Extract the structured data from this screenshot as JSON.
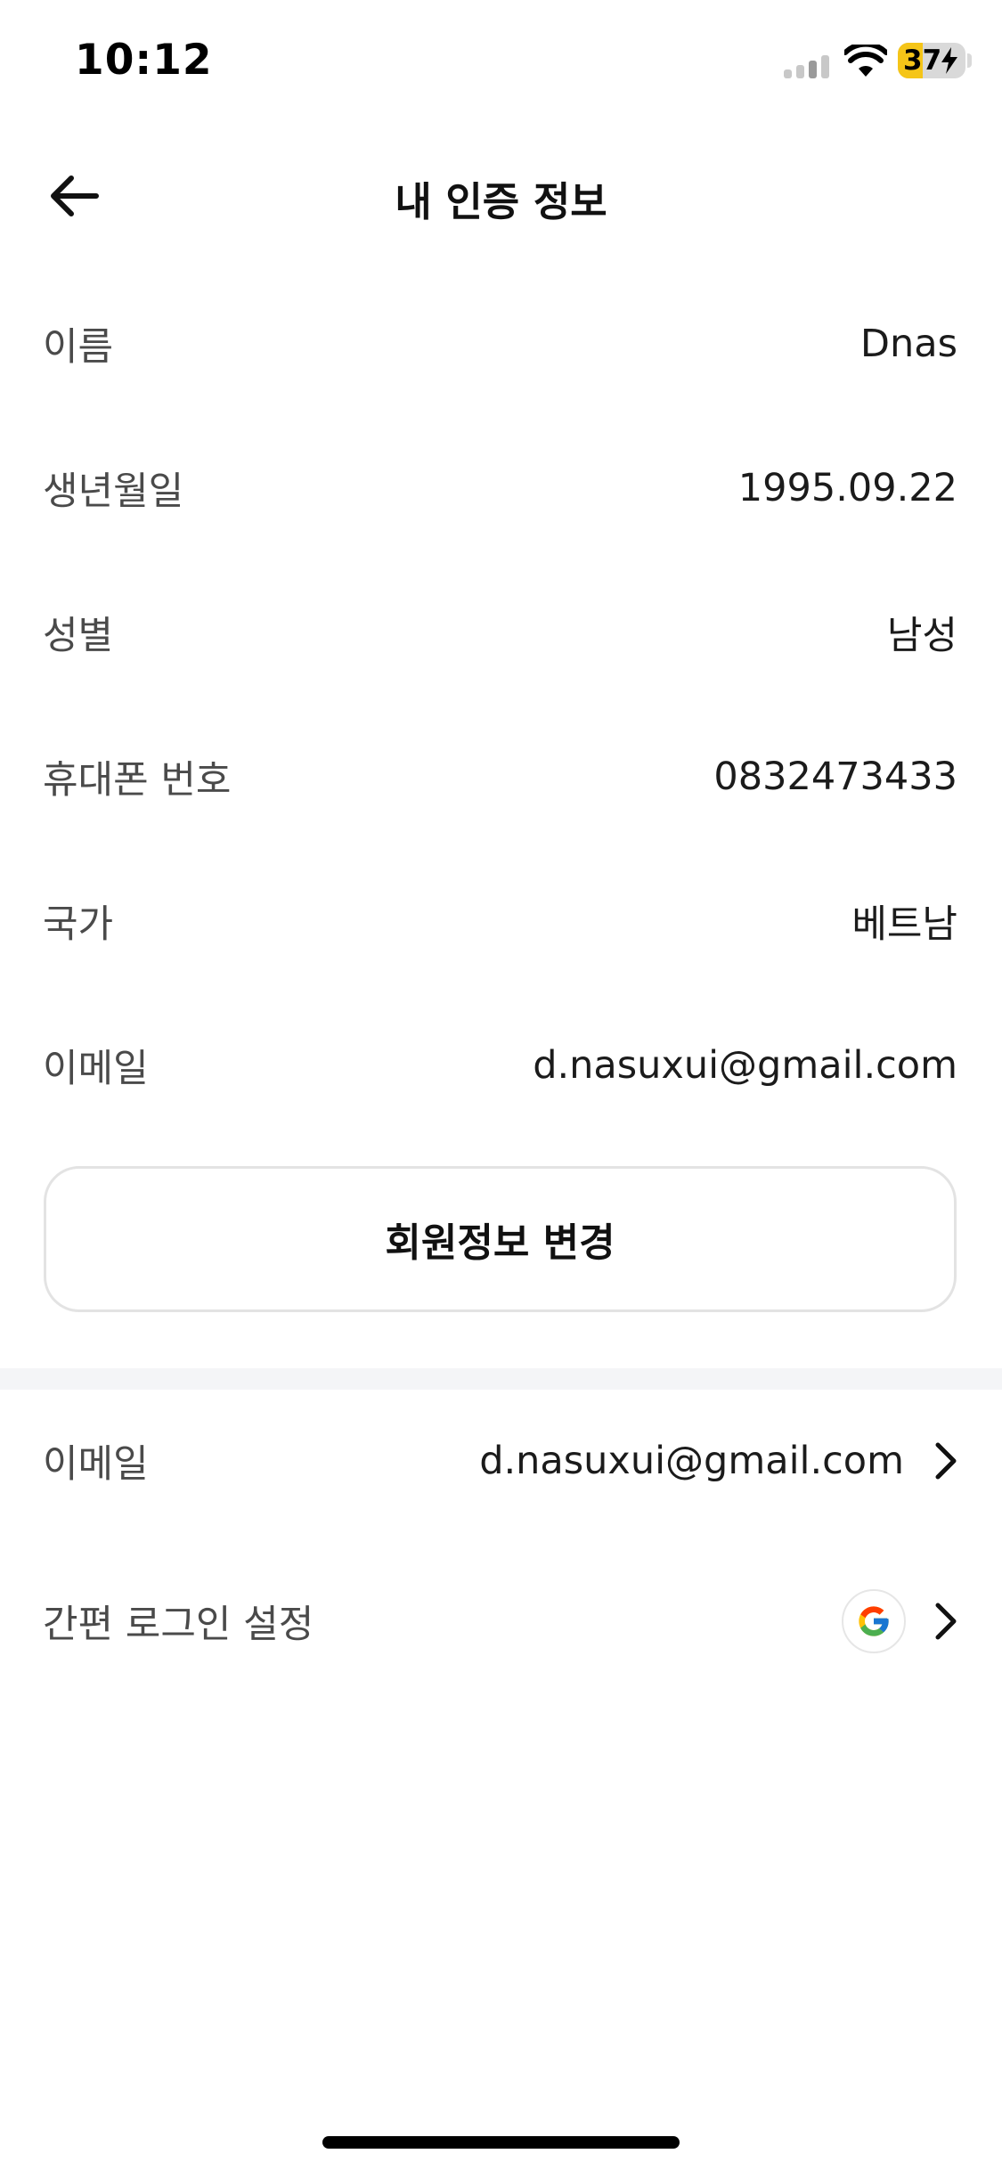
{
  "status_bar": {
    "time": "10:12",
    "battery_percent": "37",
    "battery_level": 0.37,
    "icons": [
      "cellular-signal-icon",
      "wifi-icon",
      "battery-charging-icon"
    ]
  },
  "header": {
    "title": "내 인증 정보",
    "back_icon": "arrow-left-icon"
  },
  "info": {
    "rows": [
      {
        "label": "이름",
        "value": "Dnas"
      },
      {
        "label": "생년월일",
        "value": "1995.09.22"
      },
      {
        "label": "성별",
        "value": "남성"
      },
      {
        "label": "휴대폰 번호",
        "value": "0832473433"
      },
      {
        "label": "국가",
        "value": "베트남"
      },
      {
        "label": "이메일",
        "value": "d.nasuxui@gmail.com"
      }
    ]
  },
  "edit_button": {
    "label": "회원정보 변경"
  },
  "account": {
    "email": {
      "label": "이메일",
      "value": "d.nasuxui@gmail.com",
      "icon": "chevron-right-icon"
    },
    "simple_login": {
      "label": "간편 로그인 설정",
      "provider_icon": "google-icon",
      "icon": "chevron-right-icon"
    }
  },
  "colors": {
    "battery_fill": "#f5c518",
    "divider": "#f4f5f7",
    "button_border": "#e3e3e3"
  }
}
